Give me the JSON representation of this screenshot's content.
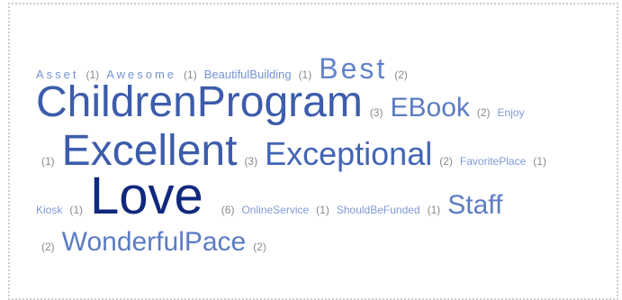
{
  "tag_cloud": {
    "rows": [
      {
        "items": [
          {
            "tag": "Asset",
            "count": "(1)"
          },
          {
            "tag": "Awesome",
            "count": "(1)"
          },
          {
            "tag": "BeautifulBuilding",
            "count": "(1)"
          },
          {
            "tag": "Best",
            "count": "(2)"
          }
        ]
      },
      {
        "items": [
          {
            "tag": "ChildrenProgram",
            "count": "(3)"
          },
          {
            "tag": "EBook",
            "count": "(2)"
          },
          {
            "tag": "Enjoy",
            "count": ""
          }
        ]
      },
      {
        "lead_count": "(1)",
        "items": [
          {
            "tag": "Excellent",
            "count": "(3)"
          },
          {
            "tag": "Exceptional",
            "count": "(2)"
          },
          {
            "tag": "FavoritePlace",
            "count": "(1)"
          }
        ]
      },
      {
        "items": [
          {
            "tag": "Kiosk",
            "count": "(1)"
          },
          {
            "tag": "Love",
            "count": "(6)"
          },
          {
            "tag": "OnlineService",
            "count": "(1)"
          },
          {
            "tag": "ShouldBeFunded",
            "count": "(1)"
          },
          {
            "tag": "Staff",
            "count": ""
          }
        ]
      },
      {
        "lead_count": "(2)",
        "items": [
          {
            "tag": "WonderfulPace",
            "count": "(2)"
          }
        ]
      }
    ]
  }
}
